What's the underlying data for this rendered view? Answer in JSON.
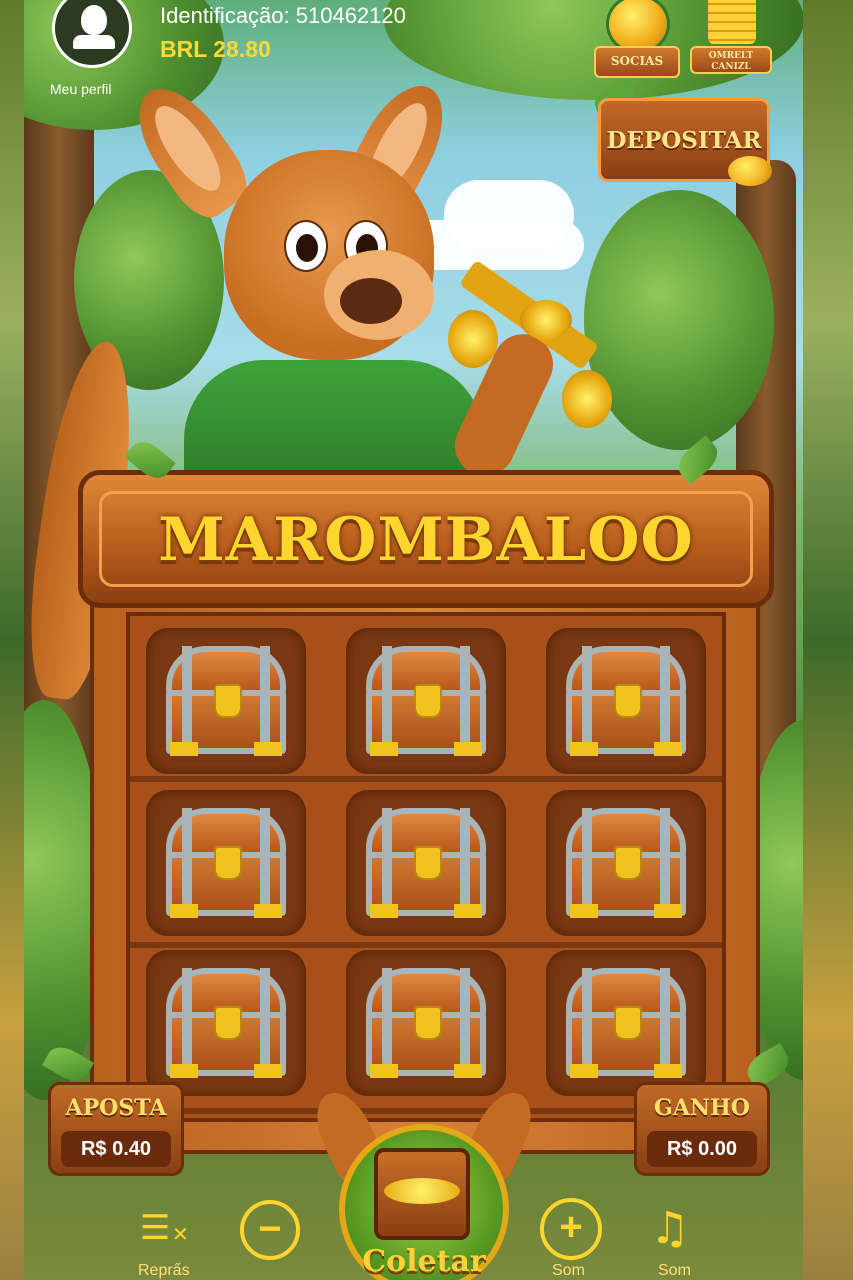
{
  "profile": {
    "label": "Meu perfil"
  },
  "header": {
    "id_text": "Identificação: 510462120",
    "balance": "BRL 28.80"
  },
  "badges": {
    "socials": "SOCIAS",
    "second": "OMRELT CANIZL"
  },
  "deposit": {
    "label": "DEPOSITAR"
  },
  "game": {
    "title": "MAROMBALOO"
  },
  "grid": {
    "chests": 9
  },
  "bet": {
    "label": "APOSTA",
    "value": "R$ 0.40"
  },
  "win": {
    "label": "GANHO",
    "value": "R$ 0.00"
  },
  "controls": {
    "rules_label": "Repra̋s",
    "collect_label": "Coletar",
    "plus_label": "Som",
    "sound_label": "Som"
  },
  "icons": {
    "avatar": "user-silhouette-icon",
    "rules": "rules-list-icon",
    "minus": "minus-circle-icon",
    "plus": "plus-circle-icon",
    "sound": "music-note-icon"
  },
  "colors": {
    "accent_gold": "#ffd52e",
    "wood": "#b8601e",
    "leaf_green": "#5aa83a"
  }
}
